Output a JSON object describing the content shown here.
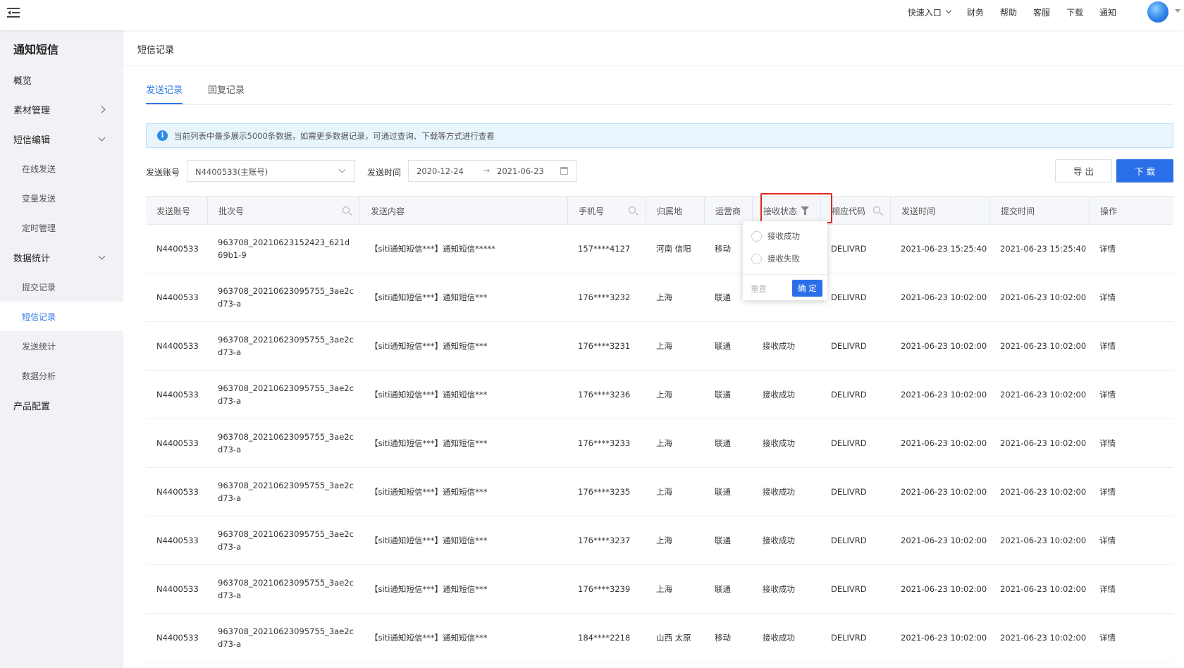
{
  "topbar": {
    "nav": [
      {
        "label": "快速入口",
        "has_dropdown": true
      },
      {
        "label": "财务"
      },
      {
        "label": "帮助"
      },
      {
        "label": "客服"
      },
      {
        "label": "下载"
      },
      {
        "label": "通知"
      }
    ]
  },
  "sidebar": {
    "title": "通知短信",
    "items": [
      {
        "label": "概览",
        "level": 1
      },
      {
        "label": "素材管理",
        "level": 1,
        "chevron": "right"
      },
      {
        "label": "短信编辑",
        "level": 1,
        "chevron": "down"
      },
      {
        "label": "在线发送",
        "level": 2
      },
      {
        "label": "变量发送",
        "level": 2
      },
      {
        "label": "定时管理",
        "level": 2
      },
      {
        "label": "数据统计",
        "level": 1,
        "chevron": "down"
      },
      {
        "label": "提交记录",
        "level": 2
      },
      {
        "label": "短信记录",
        "level": 2,
        "active": true
      },
      {
        "label": "发送统计",
        "level": 2
      },
      {
        "label": "数据分析",
        "level": 2
      },
      {
        "label": "产品配置",
        "level": 1
      }
    ]
  },
  "page": {
    "title": "短信记录"
  },
  "tabs": [
    {
      "label": "发送记录",
      "active": true
    },
    {
      "label": "回复记录"
    }
  ],
  "notice": {
    "text": "当前列表中最多展示5000条数据，如需更多数据记录，可通过查询、下载等方式进行查看"
  },
  "filters": {
    "account_label": "发送账号",
    "account_value": "N4400533(主账号)",
    "time_label": "发送时间",
    "date_start": "2020-12-24",
    "date_end": "2021-06-23"
  },
  "buttons": {
    "export": "导 出",
    "download": "下 载"
  },
  "table": {
    "columns": [
      "发送账号",
      "批次号",
      "发送内容",
      "手机号",
      "归属地",
      "运营商",
      "接收状态",
      "相应代码",
      "发送时间",
      "提交时间",
      "操作"
    ],
    "rows": [
      [
        "N4400533",
        "963708_20210623152423_621d69b1-9",
        "【siti通知短信***】通知短信*****",
        "157****4127",
        "河南 信阳",
        "移动",
        "",
        "DELIVRD",
        "2021-06-23 15:25:40",
        "2021-06-23 15:25:40",
        "详情"
      ],
      [
        "N4400533",
        "963708_20210623095755_3ae2cd73-a",
        "【siti通知短信***】通知短信***",
        "176****3232",
        "上海",
        "联通",
        "",
        "DELIVRD",
        "2021-06-23 10:02:00",
        "2021-06-23 10:02:00",
        "详情"
      ],
      [
        "N4400533",
        "963708_20210623095755_3ae2cd73-a",
        "【siti通知短信***】通知短信***",
        "176****3231",
        "上海",
        "联通",
        "接收成功",
        "DELIVRD",
        "2021-06-23 10:02:00",
        "2021-06-23 10:02:00",
        "详情"
      ],
      [
        "N4400533",
        "963708_20210623095755_3ae2cd73-a",
        "【siti通知短信***】通知短信***",
        "176****3236",
        "上海",
        "联通",
        "接收成功",
        "DELIVRD",
        "2021-06-23 10:02:00",
        "2021-06-23 10:02:00",
        "详情"
      ],
      [
        "N4400533",
        "963708_20210623095755_3ae2cd73-a",
        "【siti通知短信***】通知短信***",
        "176****3233",
        "上海",
        "联通",
        "接收成功",
        "DELIVRD",
        "2021-06-23 10:02:00",
        "2021-06-23 10:02:00",
        "详情"
      ],
      [
        "N4400533",
        "963708_20210623095755_3ae2cd73-a",
        "【siti通知短信***】通知短信***",
        "176****3235",
        "上海",
        "联通",
        "接收成功",
        "DELIVRD",
        "2021-06-23 10:02:00",
        "2021-06-23 10:02:00",
        "详情"
      ],
      [
        "N4400533",
        "963708_20210623095755_3ae2cd73-a",
        "【siti通知短信***】通知短信***",
        "176****3237",
        "上海",
        "联通",
        "接收成功",
        "DELIVRD",
        "2021-06-23 10:02:00",
        "2021-06-23 10:02:00",
        "详情"
      ],
      [
        "N4400533",
        "963708_20210623095755_3ae2cd73-a",
        "【siti通知短信***】通知短信***",
        "176****3239",
        "上海",
        "联通",
        "接收成功",
        "DELIVRD",
        "2021-06-23 10:02:00",
        "2021-06-23 10:02:00",
        "详情"
      ],
      [
        "N4400533",
        "963708_20210623095755_3ae2cd73-a",
        "【siti通知短信***】通知短信***",
        "184****2218",
        "山西 太原",
        "移动",
        "接收成功",
        "DELIVRD",
        "2021-06-23 10:02:00",
        "2021-06-23 10:02:00",
        "详情"
      ]
    ]
  },
  "status_filter": {
    "options": [
      "接收成功",
      "接收失败"
    ],
    "reset": "重置",
    "confirm": "确 定"
  }
}
